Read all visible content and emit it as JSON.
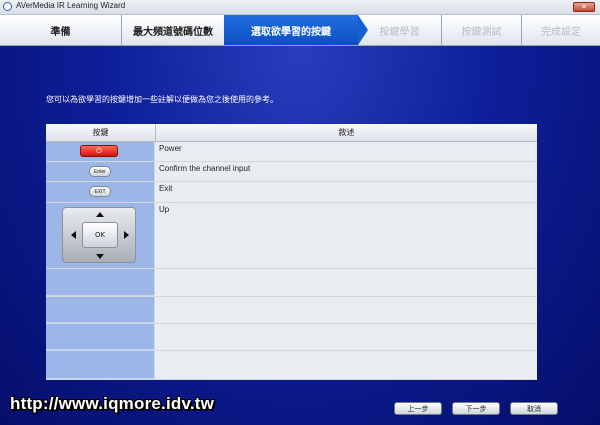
{
  "window": {
    "title": "AVerMedia IR Learning Wizard",
    "close_glyph": "✕"
  },
  "steps": [
    {
      "label": "準備",
      "state": "done"
    },
    {
      "label": "最大頻道號碼位數",
      "state": "done"
    },
    {
      "label": "選取欲學習的按鍵",
      "state": "active"
    },
    {
      "label": "按鍵學習",
      "state": "disabled"
    },
    {
      "label": "按鍵測試",
      "state": "disabled"
    },
    {
      "label": "完成設定",
      "state": "disabled"
    }
  ],
  "instruction": "您可以為欲學習的按鍵增加一些註解以便做為您之後使用的參考。",
  "table": {
    "headers": {
      "key": "按鍵",
      "desc": "敘述"
    },
    "rows": [
      {
        "icon": "power-icon",
        "glyph": "⏻",
        "desc": "Power"
      },
      {
        "button_label": "Enter",
        "desc": "Confirm the channel input"
      },
      {
        "button_label": "EXIT",
        "desc": "Exit"
      },
      {
        "dpad_label": "OK",
        "desc": "Up"
      }
    ]
  },
  "watermark": "http://www.iqmore.idv.tw",
  "buttons": {
    "back": "上一步",
    "next": "下一步",
    "cancel": "取消"
  },
  "colors": {
    "active_step": "#1460d2",
    "background": "#0b1fa8",
    "key_column": "#9bb6e7",
    "power_button": "#d0150c"
  }
}
